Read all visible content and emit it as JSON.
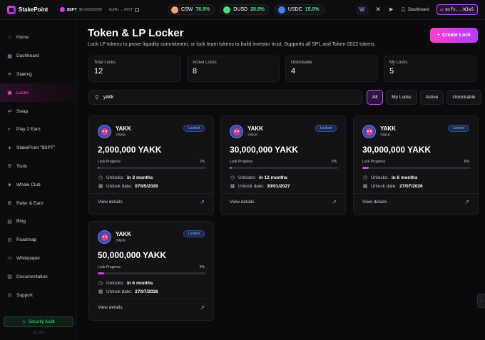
{
  "brand": {
    "name": "StakePoint"
  },
  "topbar": {
    "ticker_symbol": "$SPT",
    "ticker_price": "$0.00000090",
    "contract": "6uHA...AYST",
    "tokens": [
      {
        "symbol": "CSW",
        "change": "76.8%",
        "color": "#f4a07a"
      },
      {
        "symbol": "DUSD",
        "change": "28.9%",
        "color": "#4ade80"
      },
      {
        "symbol": "USDC",
        "change": "15.0%",
        "color": "#3b82f6"
      }
    ],
    "w_label": "W",
    "dashboard_label": "Dashboard",
    "wallet": "ecfv...WJwS"
  },
  "sidebar": {
    "items": [
      {
        "label": "Home",
        "icon": "home-icon",
        "glyph": "⌂"
      },
      {
        "label": "Dashboard",
        "icon": "grid-icon",
        "glyph": "▦"
      },
      {
        "label": "Staking",
        "icon": "layers-icon",
        "glyph": "≋"
      },
      {
        "label": "Locks",
        "icon": "lock-icon",
        "glyph": "▣",
        "active": true
      },
      {
        "label": "Swap",
        "icon": "swap-icon",
        "glyph": "⇄"
      },
      {
        "label": "Play 2 Earn",
        "icon": "gamepad-icon",
        "glyph": "◐"
      },
      {
        "label": "StakePoint \"$SPT\"",
        "icon": "star-icon",
        "glyph": "✦"
      },
      {
        "label": "Tools",
        "icon": "wrench-icon",
        "glyph": "⚙"
      },
      {
        "label": "Whale Club",
        "icon": "whale-icon",
        "glyph": "◈"
      },
      {
        "label": "Refer & Earn",
        "icon": "gift-icon",
        "glyph": "⊞"
      },
      {
        "label": "Blog",
        "icon": "document-icon",
        "glyph": "▤"
      },
      {
        "label": "Roadmap",
        "icon": "map-icon",
        "glyph": "⊟"
      },
      {
        "label": "Whitepaper",
        "icon": "file-icon",
        "glyph": "▭"
      },
      {
        "label": "Documentation",
        "icon": "book-icon",
        "glyph": "▥"
      },
      {
        "label": "Support",
        "icon": "help-icon",
        "glyph": "◎"
      }
    ],
    "audit_label": "Security Audit",
    "version": "v1.0.0"
  },
  "page": {
    "title": "Token & LP Locker",
    "subtitle": "Lock LP tokens to prove liquidity commitment, or lock team tokens to build investor trust. Supports all SPL and Token-2022 tokens.",
    "create_label": "Create Lock"
  },
  "stats": [
    {
      "label": "Total Locks",
      "value": "12"
    },
    {
      "label": "Active Locks",
      "value": "8"
    },
    {
      "label": "Unlockable",
      "value": "4"
    },
    {
      "label": "My Locks",
      "value": "5"
    }
  ],
  "search": {
    "value": "yakk"
  },
  "filters": [
    "All",
    "My Locks",
    "Active",
    "Unlockable"
  ],
  "locks": [
    {
      "name": "YAKK",
      "symbol": "YAKK",
      "status": "Locked",
      "amount": "2,000,000 YAKK",
      "progress_label": "Lock Progress",
      "progress": 1,
      "progress_text": "1%",
      "unlocks_label": "Unlocks:",
      "unlocks": "in 3 months",
      "date_label": "Unlock date:",
      "date": "07/05/2026",
      "view_label": "View details"
    },
    {
      "name": "YAKK",
      "symbol": "YAKK",
      "status": "Locked",
      "amount": "30,000,000 YAKK",
      "progress_label": "Lock Progress",
      "progress": 2,
      "progress_text": "2%",
      "unlocks_label": "Unlocks:",
      "unlocks": "in 12 months",
      "date_label": "Unlock date:",
      "date": "30/01/2027",
      "view_label": "View details"
    },
    {
      "name": "YAKK",
      "symbol": "YAKK",
      "status": "Locked",
      "amount": "30,000,000 YAKK",
      "progress_label": "Lock Progress",
      "progress": 6,
      "progress_text": "6%",
      "unlocks_label": "Unlocks:",
      "unlocks": "in 6 months",
      "date_label": "Unlock date:",
      "date": "27/07/2026",
      "view_label": "View details"
    },
    {
      "name": "YAKK",
      "symbol": "YAKK",
      "status": "Locked",
      "amount": "50,000,000 YAKK",
      "progress_label": "Lock Progress",
      "progress": 6,
      "progress_text": "6%",
      "unlocks_label": "Unlocks:",
      "unlocks": "in 6 months",
      "date_label": "Unlock date:",
      "date": "27/07/2026",
      "view_label": "View details"
    }
  ]
}
